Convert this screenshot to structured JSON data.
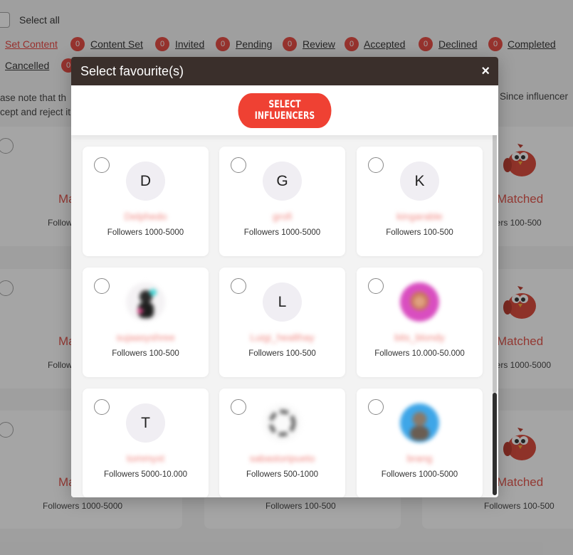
{
  "background": {
    "select_all": "Select all",
    "filters": [
      {
        "label": "Set Content",
        "active": true
      },
      {
        "label": "Content Set",
        "count": "0"
      },
      {
        "label": "Invited",
        "count": "0"
      },
      {
        "label": "Pending",
        "count": "0"
      },
      {
        "label": "Review",
        "count": "0"
      },
      {
        "label": "Accepted",
        "count": "0"
      },
      {
        "label": "Declined",
        "count": "0"
      },
      {
        "label": "Completed",
        "count": "0"
      },
      {
        "label": "Cancelled",
        "count": "0"
      }
    ],
    "note_line1": "ase note that th",
    "note_line2": "cept and reject it",
    "note_right": "Since influencer",
    "cards": [
      {
        "matched": "Ma",
        "followers": "Follow"
      },
      {
        "matched": "Matched",
        "followers": "wers  100-500"
      },
      {
        "matched": "Ma",
        "followers": "Follow"
      },
      {
        "matched": "Matched",
        "followers": "wers  1000-5000"
      },
      {
        "matched": "Ma",
        "followers": "Followers  1000-5000"
      },
      {
        "followers": "Followers  100-500"
      },
      {
        "matched": "Matched",
        "followers": "Followers  100-500"
      }
    ]
  },
  "modal": {
    "title": "Select favourite(s)",
    "close": "×",
    "button": "SELECT INFLUENCERS",
    "influencers": [
      {
        "initial": "D",
        "name": "Delphedo",
        "followers": "Followers 1000-5000"
      },
      {
        "initial": "G",
        "name": "grofi",
        "followers": "Followers 1000-5000"
      },
      {
        "initial": "K",
        "name": "kingarable",
        "followers": "Followers 100-500"
      },
      {
        "initial": "",
        "name": "sujaasyshree",
        "followers": "Followers 100-500"
      },
      {
        "initial": "L",
        "name": "Luigi_healthay",
        "followers": "Followers 100-500"
      },
      {
        "initial": "",
        "name": "bits_blondy",
        "followers": "Followers 10.000-50.000"
      },
      {
        "initial": "T",
        "name": "tommyxt",
        "followers": "Followers 5000-10.000"
      },
      {
        "initial": "",
        "name": "sabastoripueto",
        "followers": "Followers 500-1000"
      },
      {
        "initial": "",
        "name": "brang",
        "followers": "Followers 1000-5000"
      }
    ]
  },
  "colors": {
    "accent": "#ef4133",
    "header": "#3a2f2b",
    "matched": "#e0453b"
  }
}
